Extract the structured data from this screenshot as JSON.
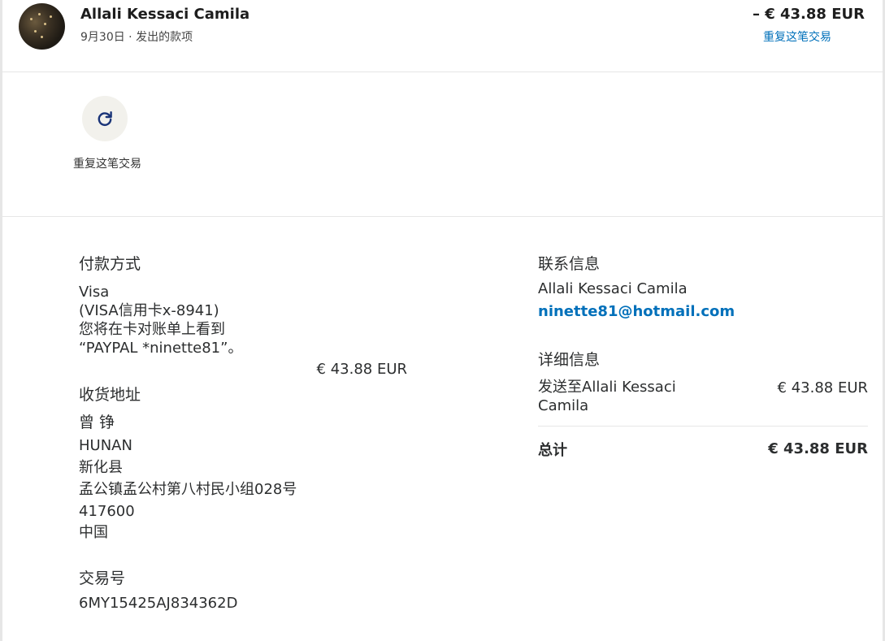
{
  "header": {
    "name": "Allali Kessaci Camila",
    "subline": "9月30日 · 发出的款项",
    "amount": "– € 43.88 EUR",
    "repeat_link": "重复这笔交易"
  },
  "actions": {
    "repeat": {
      "icon": "refresh-icon",
      "label": "重复这笔交易"
    }
  },
  "payment": {
    "title": "付款方式",
    "card_name": "Visa",
    "card_detail": "(VISA信用卡x-8941)",
    "statement_line1": "您将在卡对账单上看到",
    "statement_line2": "“PAYPAL *ninette81”。",
    "amount": "€ 43.88 EUR"
  },
  "shipping": {
    "title": "收货地址",
    "recipient": "曾 铮",
    "province": "HUNAN",
    "county": "新化县",
    "street": "孟公镇孟公村第八村民小组028号",
    "postcode": "417600",
    "country": "中国"
  },
  "transaction": {
    "title": "交易号",
    "id": "6MY15425AJ834362D"
  },
  "contact": {
    "title": "联系信息",
    "name": "Allali Kessaci Camila",
    "email": "ninette81@hotmail.com"
  },
  "details": {
    "title": "详细信息",
    "line_label_1": "发送至Allali Kessaci",
    "line_label_2": "Camila",
    "line_amount": "€ 43.88 EUR",
    "total_label": "总计",
    "total_amount": "€ 43.88 EUR"
  },
  "colors": {
    "link": "#0070ba",
    "action_bg": "#f2f1ec",
    "icon": "#1a3478",
    "divider": "#e6e6e6"
  }
}
